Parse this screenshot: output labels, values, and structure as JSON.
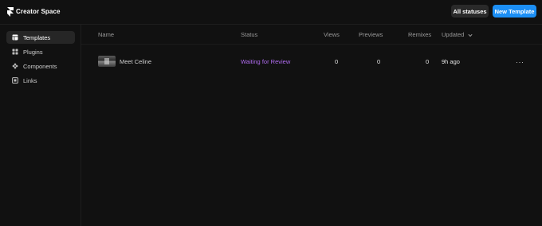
{
  "app": {
    "brand": "Creator Space"
  },
  "toolbar": {
    "all_statuses_label": "All statuses",
    "new_template_label": "New Template"
  },
  "sidebar": {
    "items": [
      {
        "label": "Templates",
        "icon": "template-icon",
        "active": true
      },
      {
        "label": "Plugins",
        "icon": "plugins-icon",
        "active": false
      },
      {
        "label": "Components",
        "icon": "components-icon",
        "active": false
      },
      {
        "label": "Links",
        "icon": "link-icon",
        "active": false
      }
    ]
  },
  "table": {
    "columns": {
      "name": "Name",
      "status": "Status",
      "views": "Views",
      "previews": "Previews",
      "remixes": "Remixes",
      "updated": "Updated"
    },
    "rows": [
      {
        "name": "Meet Celine",
        "status": "Waiting for Review",
        "views": "0",
        "previews": "0",
        "remixes": "0",
        "updated": "9h ago",
        "menu": "···"
      }
    ]
  },
  "colors": {
    "accent": "#1c8ff5",
    "status_waiting": "#b06cf0",
    "background": "#111111"
  }
}
